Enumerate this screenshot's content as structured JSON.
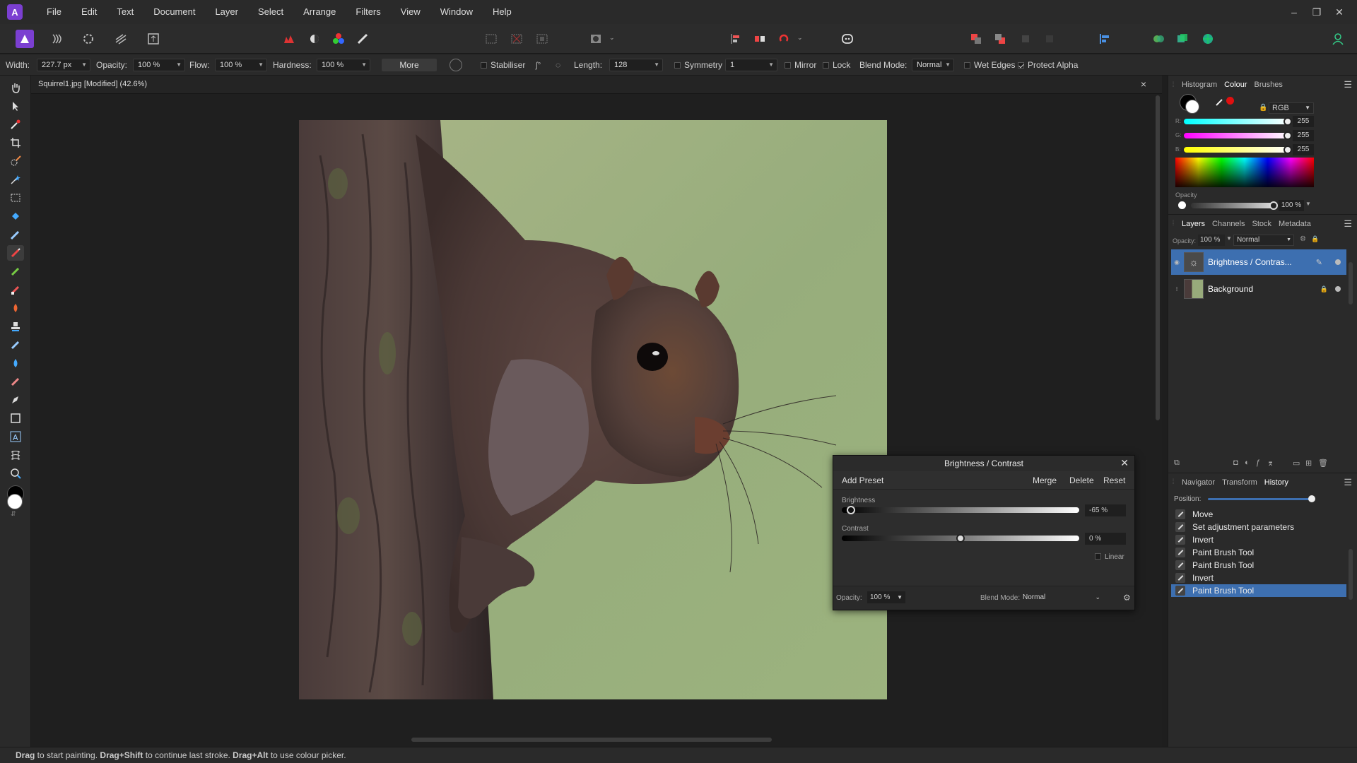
{
  "app": {
    "name": "Affinity Photo"
  },
  "menubar": {
    "items": [
      "File",
      "Edit",
      "Text",
      "Document",
      "Layer",
      "Select",
      "Arrange",
      "Filters",
      "View",
      "Window",
      "Help"
    ],
    "window_controls": [
      "–",
      "❐",
      "✕"
    ]
  },
  "context": {
    "width_label": "Width:",
    "width_value": "227.7 px",
    "opacity_label": "Opacity:",
    "opacity_value": "100 %",
    "flow_label": "Flow:",
    "flow_value": "100 %",
    "hardness_label": "Hardness:",
    "hardness_value": "100 %",
    "more_label": "More",
    "stabiliser_label": "Stabiliser",
    "length_label": "Length:",
    "length_value": "128",
    "symmetry_label": "Symmetry",
    "symmetry_value": "1",
    "mirror_label": "Mirror",
    "lock_label": "Lock",
    "blend_label": "Blend Mode:",
    "blend_value": "Normal",
    "wet_edges_label": "Wet Edges",
    "protect_alpha_label": "Protect Alpha"
  },
  "document": {
    "tab_title": "Squirrel1.jpg [Modified] (42.6%)",
    "close_glyph": "×"
  },
  "colour_panel": {
    "tabs": [
      "Histogram",
      "Colour",
      "Brushes"
    ],
    "active_tab": "Colour",
    "model": "RGB",
    "r_label": "R:",
    "r_value": "255",
    "g_label": "G:",
    "g_value": "255",
    "b_label": "B:",
    "b_value": "255",
    "opacity_label": "Opacity",
    "opacity_value": "100 %"
  },
  "layers_panel": {
    "tabs": [
      "Layers",
      "Channels",
      "Stock",
      "Metadata"
    ],
    "active_tab": "Layers",
    "opacity_label": "Opacity:",
    "opacity_value": "100 %",
    "blend_value": "Normal",
    "layers": [
      {
        "name": "Brightness / Contras...",
        "selected": true
      },
      {
        "name": "Background",
        "selected": false
      }
    ]
  },
  "history_panel": {
    "tabs": [
      "Navigator",
      "Transform",
      "History"
    ],
    "active_tab": "History",
    "position_label": "Position:",
    "items": [
      "Move",
      "Set adjustment parameters",
      "Invert",
      "Paint Brush Tool",
      "Paint Brush Tool",
      "Invert",
      "Paint Brush Tool"
    ],
    "selected_index": 6
  },
  "bc_dialog": {
    "title": "Brightness / Contrast",
    "add_preset": "Add Preset",
    "merge": "Merge",
    "delete": "Delete",
    "reset": "Reset",
    "brightness_label": "Brightness",
    "brightness_value": "-65 %",
    "brightness_level": -0.65,
    "contrast_label": "Contrast",
    "contrast_value": "0 %",
    "contrast_level": 0,
    "linear_label": "Linear",
    "opacity_label": "Opacity:",
    "opacity_value": "100 %",
    "blend_label": "Blend Mode:",
    "blend_value": "Normal"
  },
  "status": {
    "part1_bold": "Drag",
    "part1": " to start painting. ",
    "part2_bold": "Drag+Shift",
    "part2": " to continue last stroke. ",
    "part3_bold": "Drag+Alt",
    "part3": " to use colour picker."
  },
  "colors": {
    "accent": "#3d6fb0",
    "brand": "#7b3fd1",
    "fg_red": "#e01010"
  }
}
